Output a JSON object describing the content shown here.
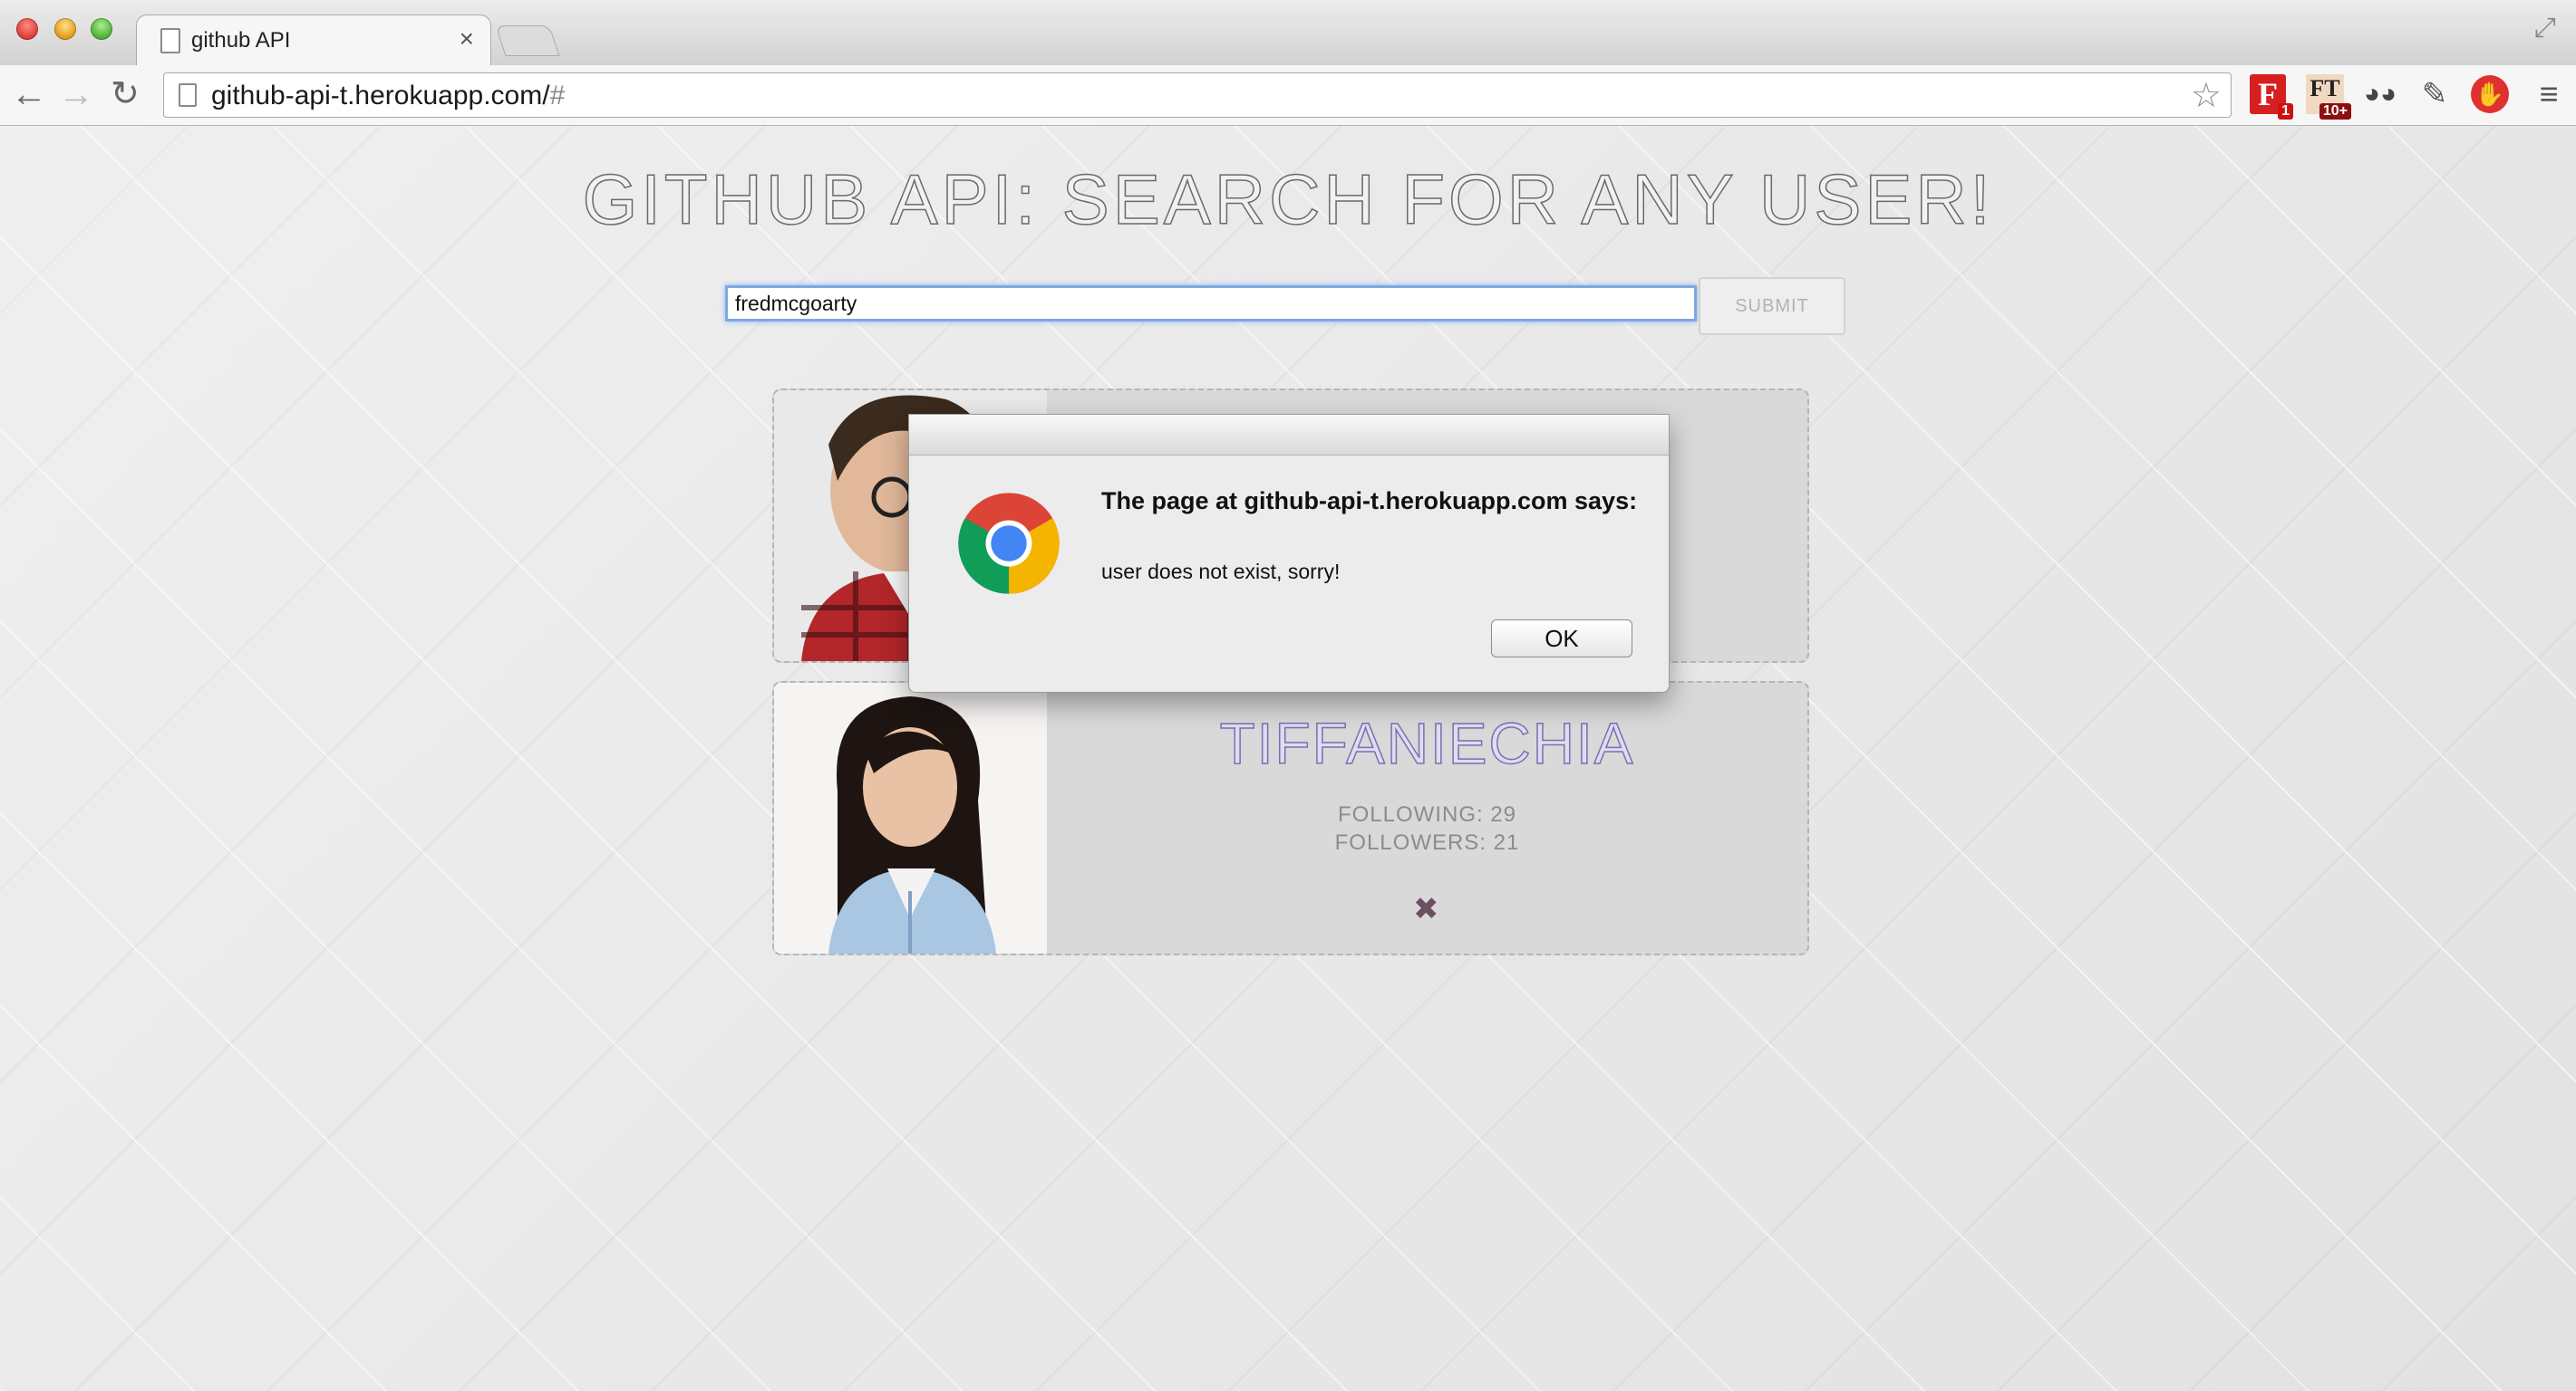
{
  "browser": {
    "tab_title": "github API",
    "tab_close": "×",
    "url_main": "github-api-t.herokuapp.com/",
    "url_tail": "#",
    "star": "☆",
    "ext_f_label": "F",
    "ext_f_badge": "1",
    "ext_ft_label": "FT",
    "ext_ft_badge": "10+"
  },
  "page": {
    "title": "GITHUB API: SEARCH FOR ANY USER!",
    "search_value": "fredmcgoarty",
    "submit_label": "SUBMIT"
  },
  "cards": [
    {
      "name": "",
      "following": "",
      "followers": "",
      "remove": "✖"
    },
    {
      "name": "TIFFANIECHIA",
      "following": "FOLLOWING: 29",
      "followers": "FOLLOWERS: 21",
      "remove": "✖"
    }
  ],
  "dialog": {
    "heading": "The page at github-api-t.herokuapp.com says:",
    "message": "user does not exist, sorry!",
    "ok_label": "OK"
  },
  "colors": {
    "accent_focus": "#7fa8e0",
    "username": "#7b6fb0",
    "remove": "#6a5060"
  }
}
